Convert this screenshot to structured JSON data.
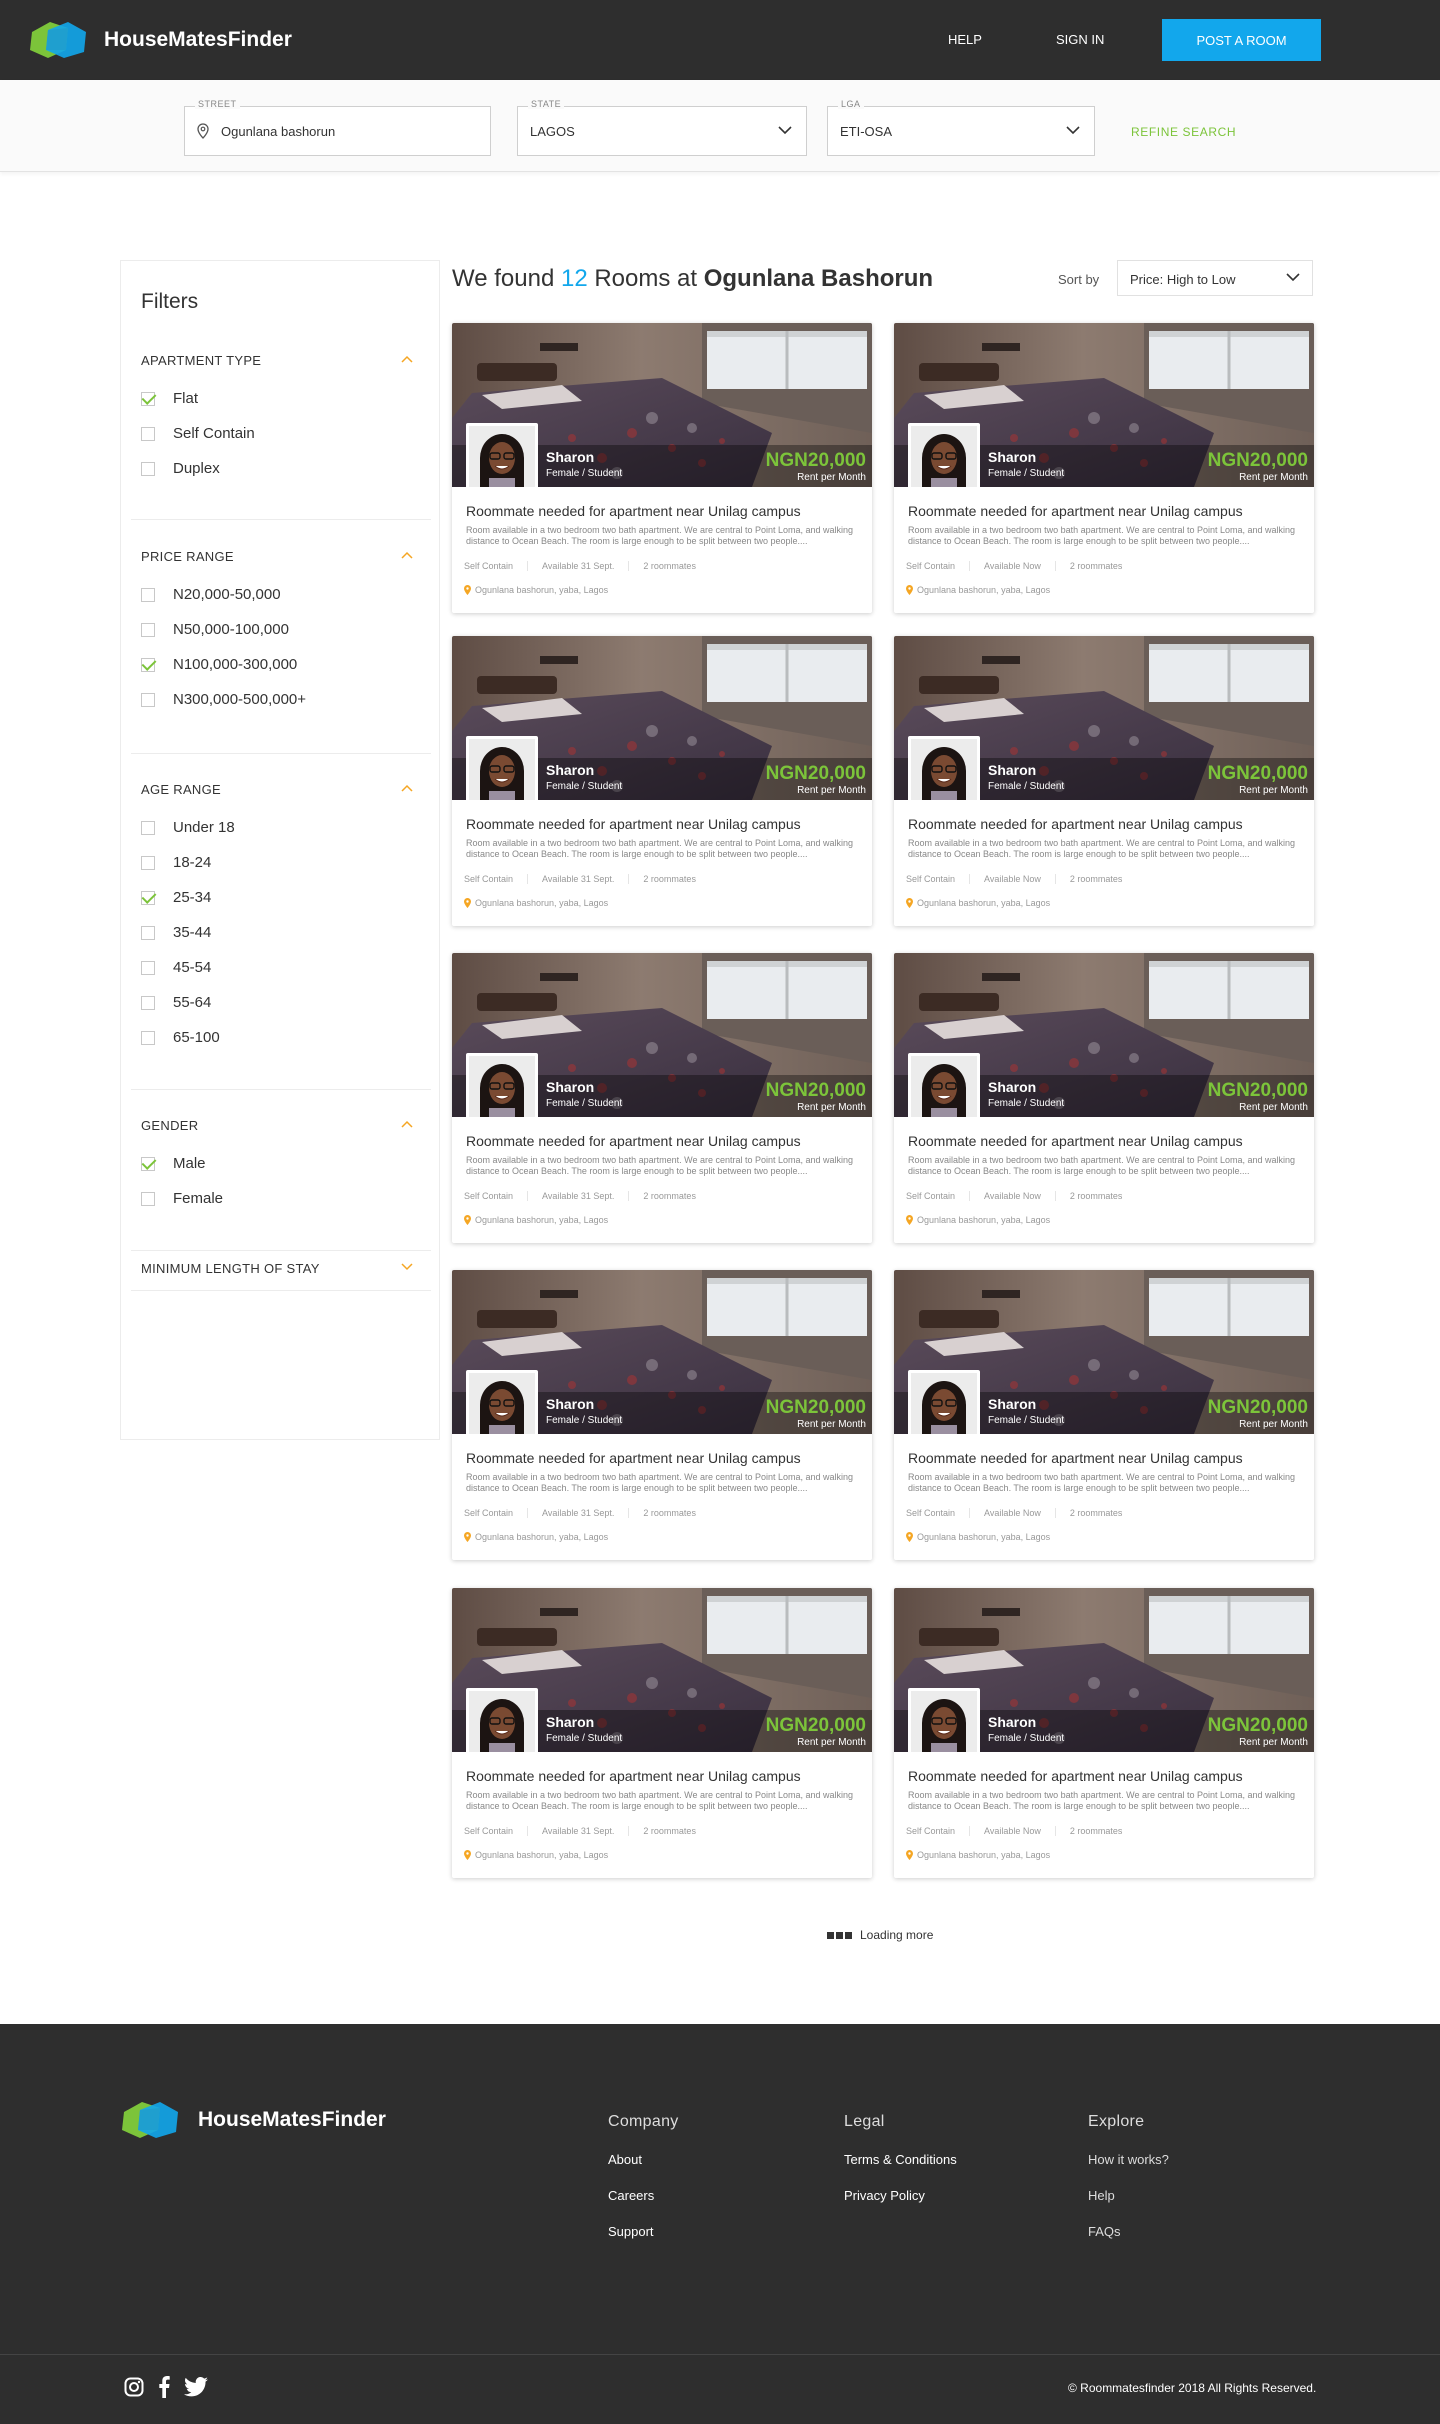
{
  "header": {
    "logo_text": "HouseMatesFinder",
    "nav": {
      "help": "HELP",
      "sign_in": "SIGN IN",
      "post_room": "POST A ROOM"
    }
  },
  "search": {
    "street": {
      "label": "STREET",
      "value": "Ogunlana bashorun"
    },
    "state": {
      "label": "STATE",
      "value": "LAGOS"
    },
    "lga": {
      "label": "LGA",
      "value": "ETI-OSA"
    },
    "refine": "REFINE SEARCH"
  },
  "filters": {
    "title": "Filters",
    "sections": [
      {
        "title": "APARTMENT TYPE",
        "options": [
          {
            "label": "Flat",
            "checked": true
          },
          {
            "label": "Self Contain",
            "checked": false
          },
          {
            "label": "Duplex",
            "checked": false
          }
        ]
      },
      {
        "title": "PRICE RANGE",
        "options": [
          {
            "label": "N20,000-50,000",
            "checked": false
          },
          {
            "label": "N50,000-100,000",
            "checked": false
          },
          {
            "label": "N100,000-300,000",
            "checked": true
          },
          {
            "label": "N300,000-500,000+",
            "checked": false
          }
        ]
      },
      {
        "title": "AGE RANGE",
        "options": [
          {
            "label": "Under 18",
            "checked": false
          },
          {
            "label": "18-24",
            "checked": false
          },
          {
            "label": "25-34",
            "checked": true
          },
          {
            "label": "35-44",
            "checked": false
          },
          {
            "label": "45-54",
            "checked": false
          },
          {
            "label": "55-64",
            "checked": false
          },
          {
            "label": "65-100",
            "checked": false
          }
        ]
      },
      {
        "title": "GENDER",
        "options": [
          {
            "label": "Male",
            "checked": true
          },
          {
            "label": "Female",
            "checked": false
          }
        ]
      }
    ],
    "collapsed_section": "MINIMUM LENGTH OF STAY"
  },
  "results": {
    "prefix": "We found",
    "count": "12",
    "middle": "Rooms at",
    "location": "Ogunlana Bashorun",
    "sort_label": "Sort by",
    "sort_value": "Price: High to Low"
  },
  "listings": [
    {
      "name": "Sharon",
      "role": "Female / Student",
      "price": "NGN20,000",
      "price_unit": "Rent per Month",
      "title": "Roommate needed for apartment near Unilag campus",
      "description": "Room available in a two bedroom two bath apartment. We are central to Point Loma, and walking distance to Ocean Beach. The room is large enough to be split between two people....",
      "type": "Self Contain",
      "availability": "Available 31 Sept.",
      "roommates": "2 roommates",
      "address": "Ogunlana bashorun, yaba, Lagos"
    },
    {
      "name": "Sharon",
      "role": "Female / Student",
      "price": "NGN20,000",
      "price_unit": "Rent per Month",
      "title": "Roommate needed for apartment near Unilag campus",
      "description": "Room available in a two bedroom two bath apartment. We are central to Point Loma, and walking distance to Ocean Beach. The room is large enough to be split between two people....",
      "type": "Self Contain",
      "availability": "Available Now",
      "roommates": "2 roommates",
      "address": "Ogunlana bashorun, yaba, Lagos"
    },
    {
      "name": "Sharon",
      "role": "Female / Student",
      "price": "NGN20,000",
      "price_unit": "Rent per Month",
      "title": "Roommate needed for apartment near Unilag campus",
      "description": "Room available in a two bedroom two bath apartment. We are central to Point Loma, and walking distance to Ocean Beach. The room is large enough to be split between two people....",
      "type": "Self Contain",
      "availability": "Available 31 Sept.",
      "roommates": "2 roommates",
      "address": "Ogunlana bashorun, yaba, Lagos"
    },
    {
      "name": "Sharon",
      "role": "Female / Student",
      "price": "NGN20,000",
      "price_unit": "Rent per Month",
      "title": "Roommate needed for apartment near Unilag campus",
      "description": "Room available in a two bedroom two bath apartment. We are central to Point Loma, and walking distance to Ocean Beach. The room is large enough to be split between two people....",
      "type": "Self Contain",
      "availability": "Available Now",
      "roommates": "2 roommates",
      "address": "Ogunlana bashorun, yaba, Lagos"
    },
    {
      "name": "Sharon",
      "role": "Female / Student",
      "price": "NGN20,000",
      "price_unit": "Rent per Month",
      "title": "Roommate needed for apartment near Unilag campus",
      "description": "Room available in a two bedroom two bath apartment. We are central to Point Loma, and walking distance to Ocean Beach. The room is large enough to be split between two people....",
      "type": "Self Contain",
      "availability": "Available 31 Sept.",
      "roommates": "2 roommates",
      "address": "Ogunlana bashorun, yaba, Lagos"
    },
    {
      "name": "Sharon",
      "role": "Female / Student",
      "price": "NGN20,000",
      "price_unit": "Rent per Month",
      "title": "Roommate needed for apartment near Unilag campus",
      "description": "Room available in a two bedroom two bath apartment. We are central to Point Loma, and walking distance to Ocean Beach. The room is large enough to be split between two people....",
      "type": "Self Contain",
      "availability": "Available Now",
      "roommates": "2 roommates",
      "address": "Ogunlana bashorun, yaba, Lagos"
    },
    {
      "name": "Sharon",
      "role": "Female / Student",
      "price": "NGN20,000",
      "price_unit": "Rent per Month",
      "title": "Roommate needed for apartment near Unilag campus",
      "description": "Room available in a two bedroom two bath apartment. We are central to Point Loma, and walking distance to Ocean Beach. The room is large enough to be split between two people....",
      "type": "Self Contain",
      "availability": "Available 31 Sept.",
      "roommates": "2 roommates",
      "address": "Ogunlana bashorun, yaba, Lagos"
    },
    {
      "name": "Sharon",
      "role": "Female / Student",
      "price": "NGN20,000",
      "price_unit": "Rent per Month",
      "title": "Roommate needed for apartment near Unilag campus",
      "description": "Room available in a two bedroom two bath apartment. We are central to Point Loma, and walking distance to Ocean Beach. The room is large enough to be split between two people....",
      "type": "Self Contain",
      "availability": "Available Now",
      "roommates": "2 roommates",
      "address": "Ogunlana bashorun, yaba, Lagos"
    },
    {
      "name": "Sharon",
      "role": "Female / Student",
      "price": "NGN20,000",
      "price_unit": "Rent per Month",
      "title": "Roommate needed for apartment near Unilag campus",
      "description": "Room available in a two bedroom two bath apartment. We are central to Point Loma, and walking distance to Ocean Beach. The room is large enough to be split between two people....",
      "type": "Self Contain",
      "availability": "Available 31 Sept.",
      "roommates": "2 roommates",
      "address": "Ogunlana bashorun, yaba, Lagos"
    },
    {
      "name": "Sharon",
      "role": "Female / Student",
      "price": "NGN20,000",
      "price_unit": "Rent per Month",
      "title": "Roommate needed for apartment near Unilag campus",
      "description": "Room available in a two bedroom two bath apartment. We are central to Point Loma, and walking distance to Ocean Beach. The room is large enough to be split between two people....",
      "type": "Self Contain",
      "availability": "Available Now",
      "roommates": "2 roommates",
      "address": "Ogunlana bashorun, yaba, Lagos"
    }
  ],
  "loading_text": "Loading more",
  "footer": {
    "logo_text": "HouseMatesFinder",
    "company": {
      "heading": "Company",
      "links": [
        "About",
        "Careers",
        "Support"
      ]
    },
    "legal": {
      "heading": "Legal",
      "links": [
        "Terms & Conditions",
        "Privacy Policy"
      ]
    },
    "explore": {
      "heading": "Explore",
      "links": [
        "How it works?",
        "Help",
        "FAQs"
      ]
    },
    "copyright": "© Roommatesfinder 2018 All Rights Reserved.",
    "social_icons": [
      "instagram-icon",
      "facebook-icon",
      "twitter-icon"
    ]
  },
  "colors": {
    "brand_blue": "#12a7ec",
    "brand_green": "#7cc43a",
    "accent_orange": "#f5a623",
    "dark": "#2e2e2e"
  }
}
